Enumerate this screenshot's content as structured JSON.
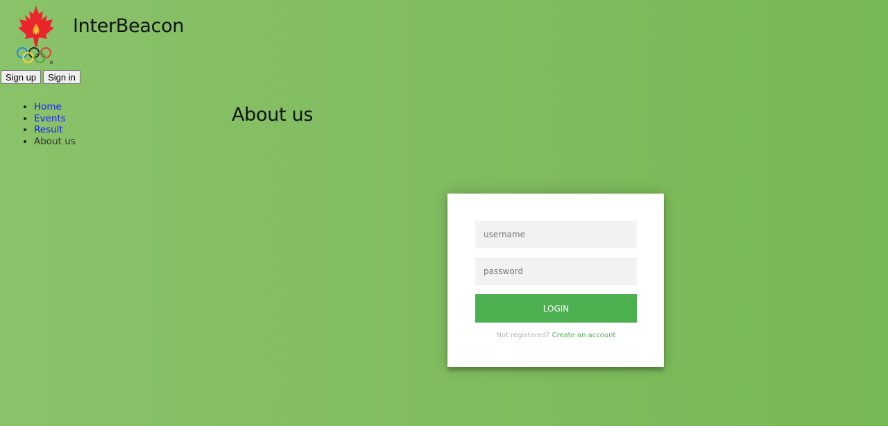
{
  "header": {
    "site_title": "InterBeacon",
    "logo_icon": "maple-leaf-olympic-rings-logo"
  },
  "auth": {
    "signup_label": "Sign up",
    "signin_label": "Sign in"
  },
  "nav": {
    "items": [
      {
        "label": "Home"
      },
      {
        "label": "Events"
      },
      {
        "label": "Result"
      },
      {
        "label": "About us"
      }
    ]
  },
  "main": {
    "heading": "About us"
  },
  "login": {
    "username_placeholder": "username",
    "password_placeholder": "password",
    "button_label": "login",
    "not_registered_text": "Not registered?",
    "create_account_link": "Create an account"
  },
  "colors": {
    "accent": "#4caf50",
    "background_start": "#8ac269",
    "background_end": "#76b853",
    "link": "#1a1aff"
  }
}
